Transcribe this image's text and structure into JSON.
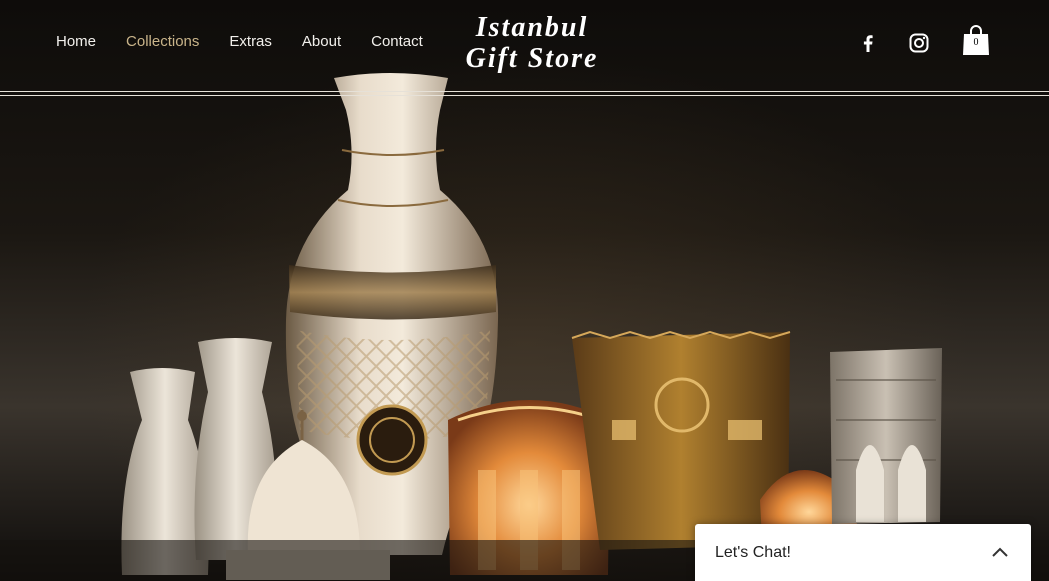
{
  "header": {
    "nav": [
      {
        "label": "Home",
        "active": false
      },
      {
        "label": "Collections",
        "active": true
      },
      {
        "label": "Extras",
        "active": false
      },
      {
        "label": "About",
        "active": false
      },
      {
        "label": "Contact",
        "active": false
      }
    ],
    "brand_line1": "Istanbul",
    "brand_line2": "Gift Store",
    "social": [
      {
        "icon": "facebook-icon"
      },
      {
        "icon": "instagram-icon"
      }
    ],
    "cart": {
      "icon": "shopping-bag-icon",
      "count": "0"
    }
  },
  "chat": {
    "label": "Let's Chat!",
    "toggle_icon": "chevron-up-icon"
  },
  "colors": {
    "nav_text": "#f2f0ec",
    "nav_active": "#c9b48a",
    "chat_bg": "#ffffff",
    "background": "#0d0b09"
  }
}
